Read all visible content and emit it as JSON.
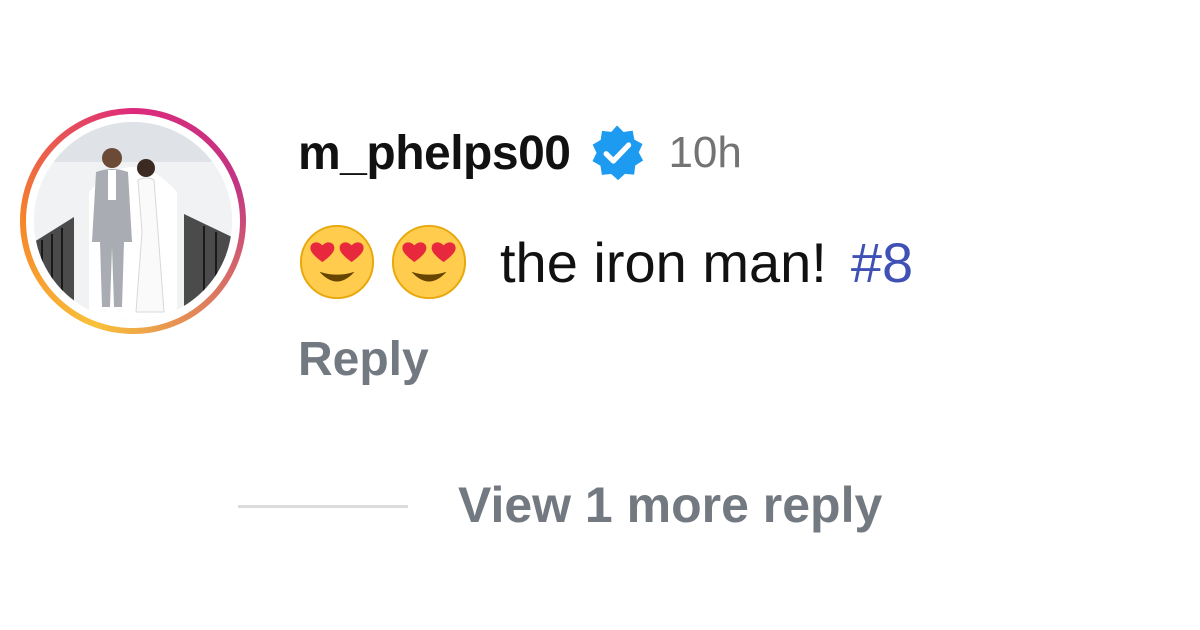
{
  "comment": {
    "username": "m_phelps00",
    "verified": true,
    "timestamp": "10h",
    "text": "the iron man!",
    "hashtag": "#8",
    "emoji": [
      "heart-eyes-emoji",
      "heart-eyes-emoji"
    ],
    "reply_label": "Reply",
    "view_more_label": "View 1 more reply"
  },
  "colors": {
    "verified_badge": "#1d9bf0",
    "hashtag": "#3f51b5",
    "muted_text": "#737980",
    "story_ring": [
      "#f9c13a",
      "#f58529",
      "#dd2a7b",
      "#c13584"
    ]
  }
}
